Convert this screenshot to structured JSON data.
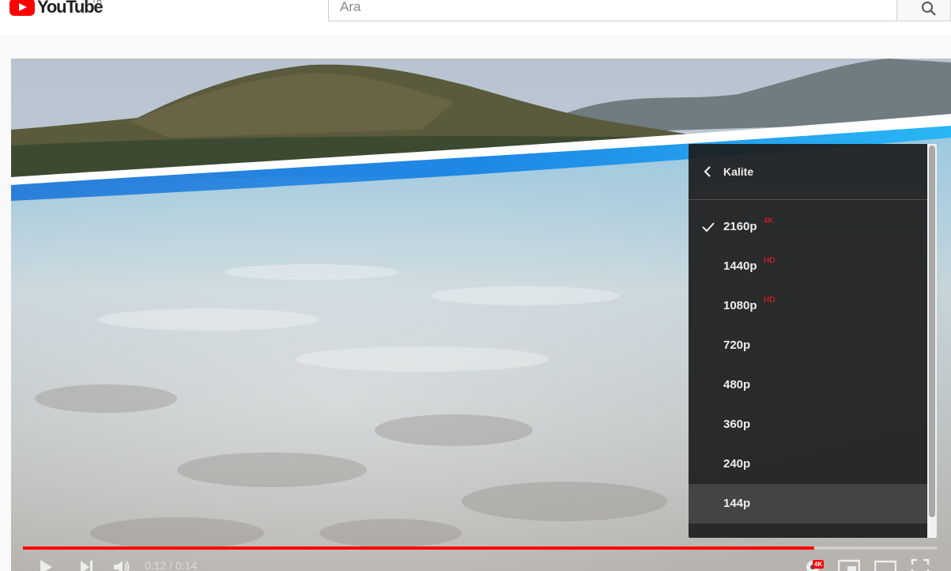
{
  "masthead": {
    "logo_text": "YouTube",
    "country_code": "TR",
    "search_placeholder": "Ara"
  },
  "player": {
    "current_time": "0:12",
    "duration": "0:14",
    "time_separator": " / ",
    "progress_fraction": 0.866,
    "quality_badge": "4K",
    "quality_menu": {
      "title": "Kalite",
      "options": [
        {
          "label": "2160p",
          "badge": "4K",
          "selected": true
        },
        {
          "label": "1440p",
          "badge": "HD",
          "selected": false
        },
        {
          "label": "1080p",
          "badge": "HD",
          "selected": false
        },
        {
          "label": "720p",
          "badge": "",
          "selected": false
        },
        {
          "label": "480p",
          "badge": "",
          "selected": false
        },
        {
          "label": "360p",
          "badge": "",
          "selected": false
        },
        {
          "label": "240p",
          "badge": "",
          "selected": false
        },
        {
          "label": "144p",
          "badge": "",
          "selected": false,
          "hovered": true
        }
      ]
    }
  },
  "colors": {
    "brand_red": "#ff0000",
    "progress_red": "#ff0000",
    "badge_red": "#ff1a1a"
  }
}
